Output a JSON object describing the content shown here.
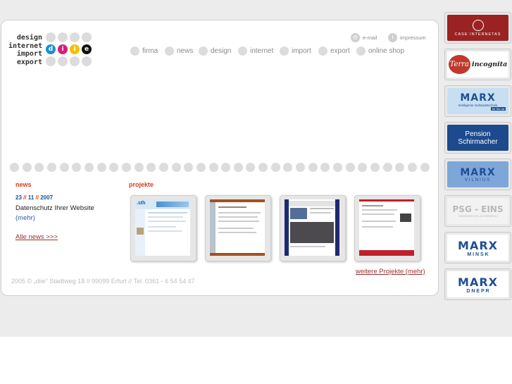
{
  "logo": {
    "words": [
      "design",
      "internet",
      "import",
      "export"
    ],
    "letters": [
      "d",
      "i",
      "i",
      "e"
    ],
    "letter_colors": [
      "#1a8fd6",
      "#d81b7e",
      "#f2c200",
      "#111111"
    ]
  },
  "top_links": [
    {
      "label": "e-mail",
      "icon": "email-icon",
      "glyph": "@"
    },
    {
      "label": "impressum",
      "icon": "info-icon",
      "glyph": "i"
    }
  ],
  "nav": [
    "firma",
    "news",
    "design",
    "internet",
    "import",
    "export",
    "online shop"
  ],
  "news": {
    "title": "news",
    "day": "23",
    "month": "11",
    "year": "2007",
    "sep": "//",
    "text": "Datenschutz Ihrer Website",
    "more": "(mehr)",
    "all": "Alle news >>>"
  },
  "projects": {
    "title": "projekte",
    "more": "weitere Projekte (mehr)",
    "thumb_logo": ".sth"
  },
  "footer": {
    "copyright": "2005 © „diie“ Stadtweg 18 // 99099 Erfurt // Tel. 0361 - 6 54 54 47"
  },
  "partners": [
    {
      "line1": "",
      "line2": "CASE INTERNETAS",
      "bg": "#9b2222",
      "fg": "#ffffff"
    },
    {
      "line1": "Terra",
      "line2": "incognita",
      "bg": "#ffffff",
      "fg": "#b8332b"
    },
    {
      "line1": "MARX",
      "line2": "Intelligente Gebäudetechnik",
      "badge": "für Sie da",
      "bg": "#c7dff0",
      "fg": "#1f4f94"
    },
    {
      "line1": "Pension",
      "line2": "Schirmacher",
      "bg": "#1d4a8c",
      "fg": "#ffffff"
    },
    {
      "line1": "MARX",
      "line2": "VILNIUS",
      "bg": "#7ea6d8",
      "fg": "#1f4f94"
    },
    {
      "line1": "PSG - EINS",
      "line2": "MEHRZWECKS-SCHIEBERAI",
      "bg": "#f2f2f2",
      "fg": "#b8b8b8"
    },
    {
      "line1": "MARX",
      "line2": "M I N S K",
      "bg": "#ffffff",
      "fg": "#1f4f94"
    },
    {
      "line1": "MARX",
      "line2": "D N E P R",
      "bg": "#ffffff",
      "fg": "#1f4f94"
    }
  ],
  "colors": {
    "accent_red": "#d4401a",
    "link_blue": "#2a5aa8",
    "link_dark_red": "#9b2f2f",
    "dot_grey": "#dcdcdc"
  }
}
